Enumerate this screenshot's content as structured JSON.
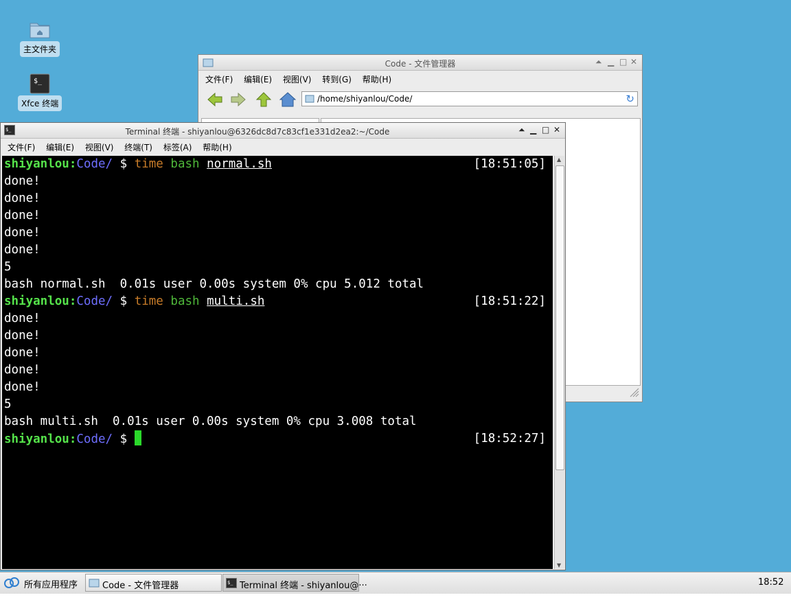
{
  "desktop": {
    "icons": [
      {
        "label": "主文件夹"
      },
      {
        "label": "Xfce 终端"
      }
    ]
  },
  "file_manager": {
    "title": "Code - 文件管理器",
    "menu": [
      "文件(F)",
      "编辑(E)",
      "视图(V)",
      "转到(G)",
      "帮助(H)"
    ],
    "address": "/home/shiyanlou/Code/"
  },
  "terminal": {
    "title": "Terminal 终端 - shiyanlou@6326dc8d7c83cf1e331d2ea2:~/Code",
    "menu": [
      "文件(F)",
      "编辑(E)",
      "视图(V)",
      "终端(T)",
      "标签(A)",
      "帮助(H)"
    ],
    "prompt_user": "shiyanlou",
    "prompt_dir": "Code/",
    "prompt_symbol": "$",
    "cmd1": {
      "time": "time",
      "bash": "bash",
      "arg": "normal.sh",
      "timestamp": "[18:51:05]"
    },
    "out1": [
      "done!",
      "done!",
      "done!",
      "done!",
      "done!",
      "5"
    ],
    "summary1": "bash normal.sh  0.01s user 0.00s system 0% cpu 5.012 total",
    "cmd2": {
      "time": "time",
      "bash": "bash",
      "arg": "multi.sh",
      "timestamp": "[18:51:22]"
    },
    "out2": [
      "done!",
      "done!",
      "done!",
      "done!",
      "done!",
      "5"
    ],
    "summary2": "bash multi.sh  0.01s user 0.00s system 0% cpu 3.008 total",
    "cmd3": {
      "timestamp": "[18:52:27]"
    }
  },
  "taskbar": {
    "apps_menu": "所有应用程序",
    "tasks": [
      "Code - 文件管理器",
      "Terminal 终端 - shiyanlou@···"
    ],
    "clock": "18:52"
  },
  "colors": {
    "desktop_bg": "#53acd8",
    "prompt_user": "#55e24a",
    "prompt_dir": "#6e6eff",
    "cmd_time": "#c87c29",
    "cmd_bash": "#4fb83a",
    "cursor": "#2ad82a"
  }
}
